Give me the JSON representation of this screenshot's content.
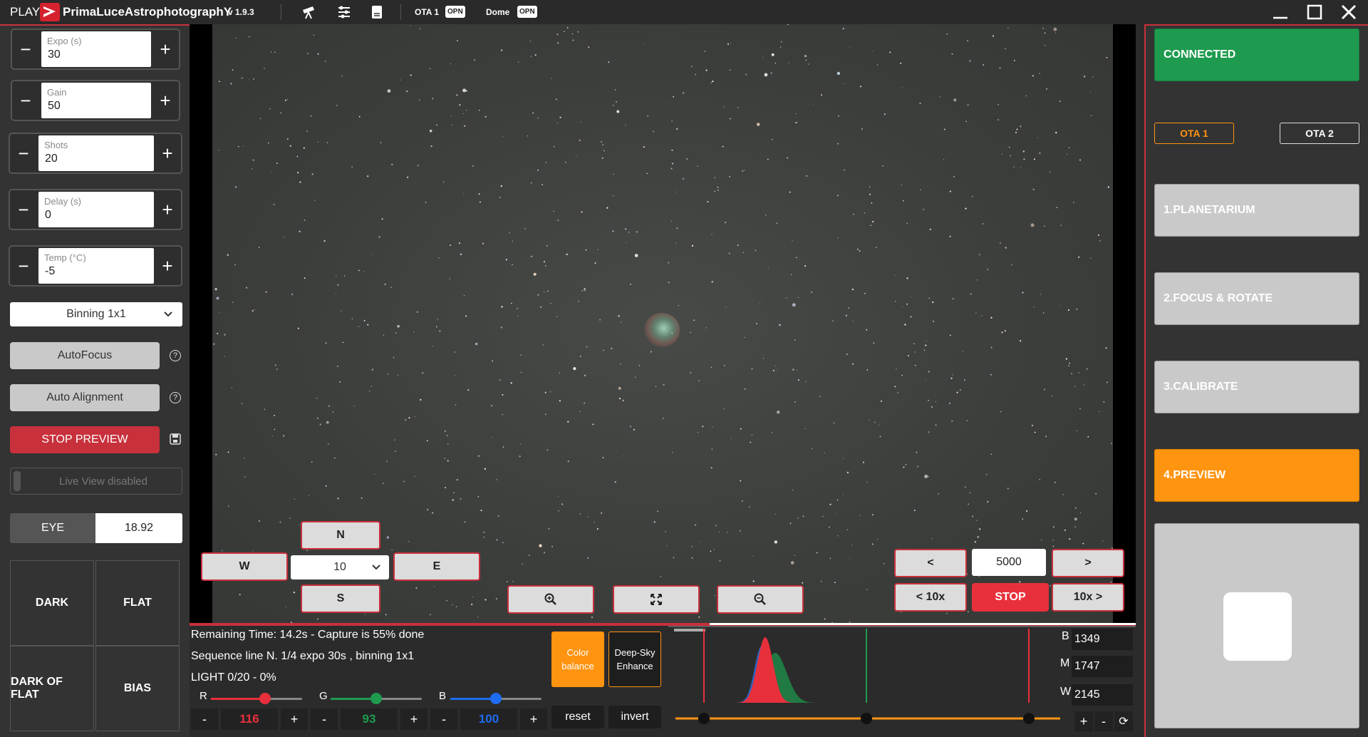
{
  "titlebar": {
    "prefix": "PLAY",
    "brand": "PrimaLuceAstrophotographY",
    "version": "v 1.9.3",
    "ota_label": "OTA 1",
    "ota_status": "OPN",
    "dome_label": "Dome",
    "dome_status": "OPN"
  },
  "left": {
    "steppers": [
      {
        "label": "Expo (s)",
        "value": "30"
      },
      {
        "label": "Gain",
        "value": "50"
      },
      {
        "label": "Shots",
        "value": "20"
      },
      {
        "label": "Delay (s)",
        "value": "0"
      },
      {
        "label": "Temp (°C)",
        "value": "-5"
      }
    ],
    "minus": "−",
    "plus": "+",
    "binning": "Binning 1x1",
    "autofocus": "AutoFocus",
    "auto_alignment": "Auto Alignment",
    "help": "?",
    "stop_preview": "STOP PREVIEW",
    "live_view": "Live View disabled",
    "eye_label": "EYE",
    "eye_value": "18.92",
    "frames": [
      "DARK",
      "FLAT",
      "DARK OF FLAT",
      "BIAS"
    ]
  },
  "image": {
    "north": "N",
    "south": "S",
    "west": "W",
    "east": "E",
    "step_value": "10",
    "prev": "<",
    "next": ">",
    "prev10": "< 10x",
    "next10": "10x >",
    "counter": "5000",
    "stop": "STOP"
  },
  "bottom": {
    "remaining": "Remaining Time: 14.2s  -  Capture is 55% done",
    "sequence": "Sequence line N. 1/4 expo 30s , binning 1x1",
    "light": "LIGHT 0/20 - 0%",
    "progress": 0.55,
    "r_label": "R",
    "g_label": "G",
    "b_label": "B",
    "r_value": "116",
    "g_value": "93",
    "b_value": "100",
    "minus": "-",
    "plus": "+",
    "color_balance": "Color balance",
    "deep_sky": "Deep-Sky Enhance",
    "reset": "reset",
    "invert": "invert",
    "hist_b_label": "B",
    "hist_b": "1349",
    "hist_m_label": "M",
    "hist_m": "1747",
    "hist_w_label": "W",
    "hist_w": "2145",
    "refresh": "⟳"
  },
  "right": {
    "status": "CONNECTED",
    "ota1": "OTA 1",
    "ota2": "OTA 2",
    "menu": [
      "1.PLANETARIUM",
      "2.FOCUS & ROTATE",
      "3.CALIBRATE",
      "4.PREVIEW"
    ]
  },
  "colors": {
    "accent_red": "#c8303c",
    "connected_green": "#1e9b4f",
    "preview_orange": "#ff9410",
    "stop_red": "#e8303c"
  }
}
